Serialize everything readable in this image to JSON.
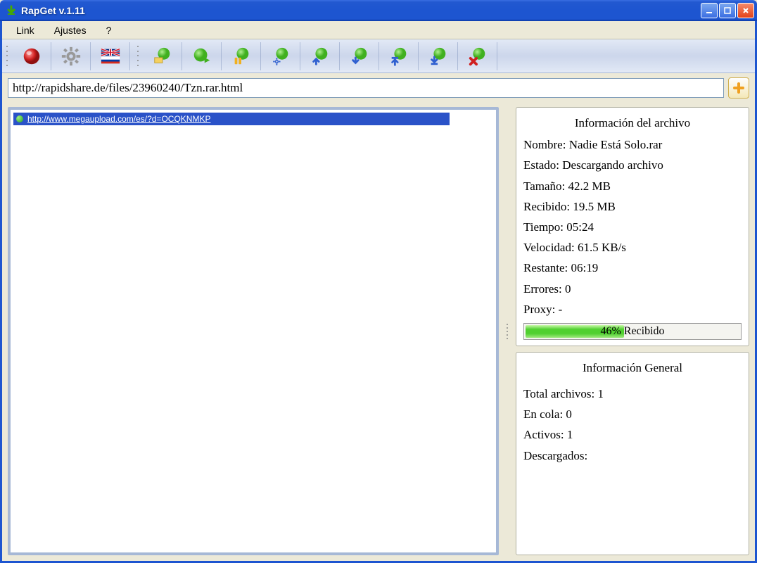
{
  "window": {
    "title": "RapGet v.1.11"
  },
  "menu": {
    "link": "Link",
    "settings": "Ajustes",
    "help": "?"
  },
  "url_input": {
    "value": "http://rapidshare.de/files/23960240/Tzn.rar.html"
  },
  "list": {
    "items": [
      {
        "url": "http://www.megaupload.com/es/?d=OCQKNMKP"
      }
    ]
  },
  "file_info": {
    "title": "Información del archivo",
    "name_label": "Nombre:",
    "name_value": "Nadie Está Solo.rar",
    "state_label": "Estado:",
    "state_value": "Descargando archivo",
    "size_label": "Tamaño:",
    "size_value": "42.2 MB",
    "received_label": "Recibido:",
    "received_value": "19.5 MB",
    "time_label": "Tiempo:",
    "time_value": "05:24",
    "speed_label": "Velocidad:",
    "speed_value": "61.5 KB/s",
    "remaining_label": "Restante:",
    "remaining_value": "06:19",
    "errors_label": "Errores:",
    "errors_value": "0",
    "proxy_label": "Proxy:",
    "proxy_value": "-",
    "progress_percent": 46,
    "progress_text": "46% Recibido"
  },
  "general_info": {
    "title": "Información General",
    "total_label": "Total archivos:",
    "total_value": "1",
    "queue_label": "En cola:",
    "queue_value": "0",
    "active_label": "Activos:",
    "active_value": "1",
    "downloaded_label": "Descargados:",
    "downloaded_value": ""
  }
}
